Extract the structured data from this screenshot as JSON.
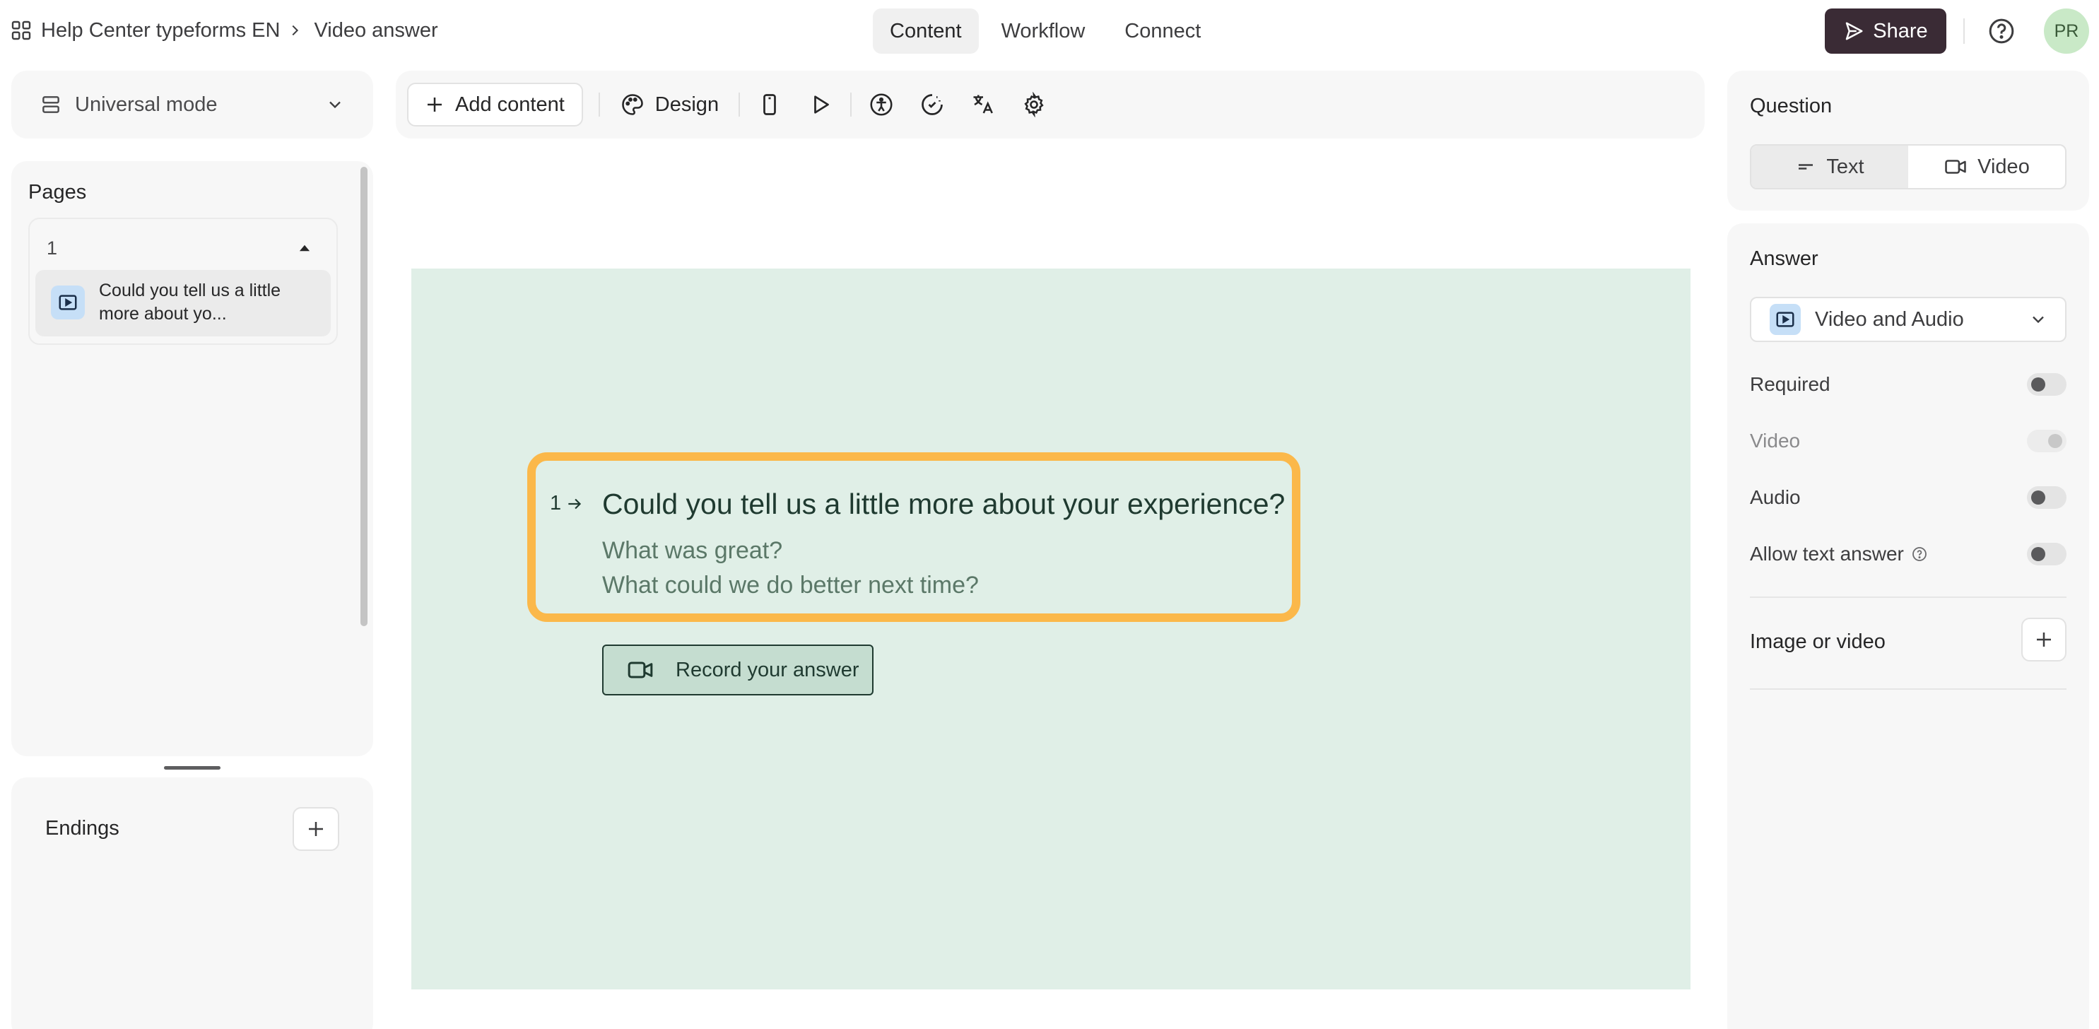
{
  "header": {
    "workspace": "Help Center typeforms EN",
    "form_name": "Video answer",
    "tabs": [
      {
        "label": "Content",
        "active": true
      },
      {
        "label": "Workflow",
        "active": false
      },
      {
        "label": "Connect",
        "active": false
      }
    ],
    "share_label": "Share",
    "avatar_initials": "PR"
  },
  "left": {
    "mode_label": "Universal mode",
    "pages_title": "Pages",
    "page_group_number": "1",
    "page_item_label": "Could you tell us a little more about yo...",
    "endings_title": "Endings"
  },
  "toolbar": {
    "add_content": "Add content",
    "design": "Design"
  },
  "canvas": {
    "question_number": "1",
    "question_title": "Could you tell us a little more about your experience?",
    "description_line1": "What was great?",
    "description_line2": "What could we do better next time?",
    "record_label": "Record your answer",
    "background": "#e0efe7",
    "highlight_color": "#fbb84a"
  },
  "right": {
    "question_title": "Question",
    "question_modes": [
      {
        "label": "Text",
        "active": true
      },
      {
        "label": "Video",
        "active": false
      }
    ],
    "answer_title": "Answer",
    "answer_type": "Video and Audio",
    "options": [
      {
        "label": "Required",
        "enabled": true
      },
      {
        "label": "Video",
        "enabled": false
      },
      {
        "label": "Audio",
        "enabled": true
      },
      {
        "label": "Allow text answer",
        "enabled": true
      }
    ],
    "image_or_video": "Image or video"
  },
  "colors": {
    "share_bg": "#3a2b35",
    "avatar_bg": "#c9e9c7",
    "icon_tile_bg": "#c6dff7"
  }
}
